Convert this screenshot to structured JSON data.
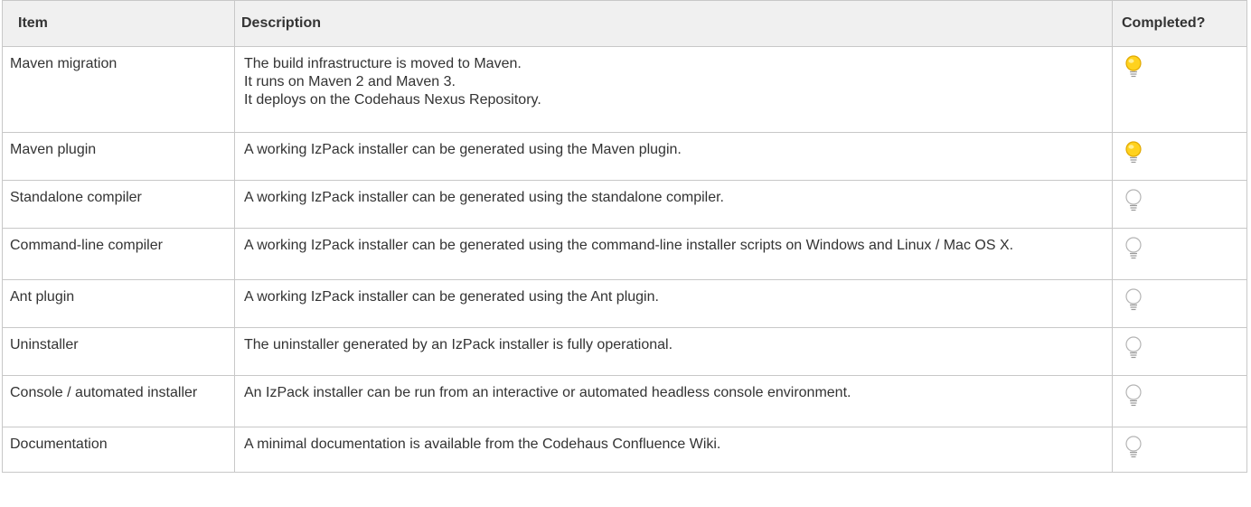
{
  "table": {
    "headers": {
      "item": "Item",
      "description": "Description",
      "completed": "Completed?"
    },
    "rows": [
      {
        "item": "Maven migration",
        "description": [
          "The build infrastructure is moved to Maven.",
          "It runs on Maven 2 and Maven 3.",
          "It deploys on the Codehaus Nexus Repository."
        ],
        "completed": "yes",
        "status_icon": "lightbulb-on-icon"
      },
      {
        "item": "Maven plugin",
        "description": [
          "A working IzPack installer can be generated using the Maven plugin."
        ],
        "completed": "yes",
        "status_icon": "lightbulb-on-icon"
      },
      {
        "item": "Standalone compiler",
        "description": [
          "A working IzPack installer can be generated using the standalone compiler."
        ],
        "completed": "no",
        "status_icon": "lightbulb-off-icon"
      },
      {
        "item": "Command-line compiler",
        "description": [
          "A working IzPack installer can be generated using the command-line installer scripts on Windows and Linux / Mac OS X."
        ],
        "completed": "no",
        "status_icon": "lightbulb-off-icon"
      },
      {
        "item": "Ant plugin",
        "description": [
          "A working IzPack installer can be generated using the Ant plugin."
        ],
        "completed": "no",
        "status_icon": "lightbulb-off-icon"
      },
      {
        "item": "Uninstaller",
        "description": [
          "The uninstaller generated by an IzPack installer is fully operational."
        ],
        "completed": "no",
        "status_icon": "lightbulb-off-icon"
      },
      {
        "item": "Console / automated installer",
        "description": [
          "An IzPack installer can be run from an interactive or automated headless console environment."
        ],
        "completed": "no",
        "status_icon": "lightbulb-off-icon"
      },
      {
        "item": "Documentation",
        "description": [
          "A minimal documentation is available from the Codehaus Confluence Wiki."
        ],
        "completed": "no",
        "status_icon": "lightbulb-off-icon"
      }
    ]
  },
  "colors": {
    "header_bg": "#f0f0f0",
    "border": "#c8c8c8",
    "text": "#333333",
    "bulb_on": "#ffd21e",
    "bulb_off": "#ffffff"
  }
}
